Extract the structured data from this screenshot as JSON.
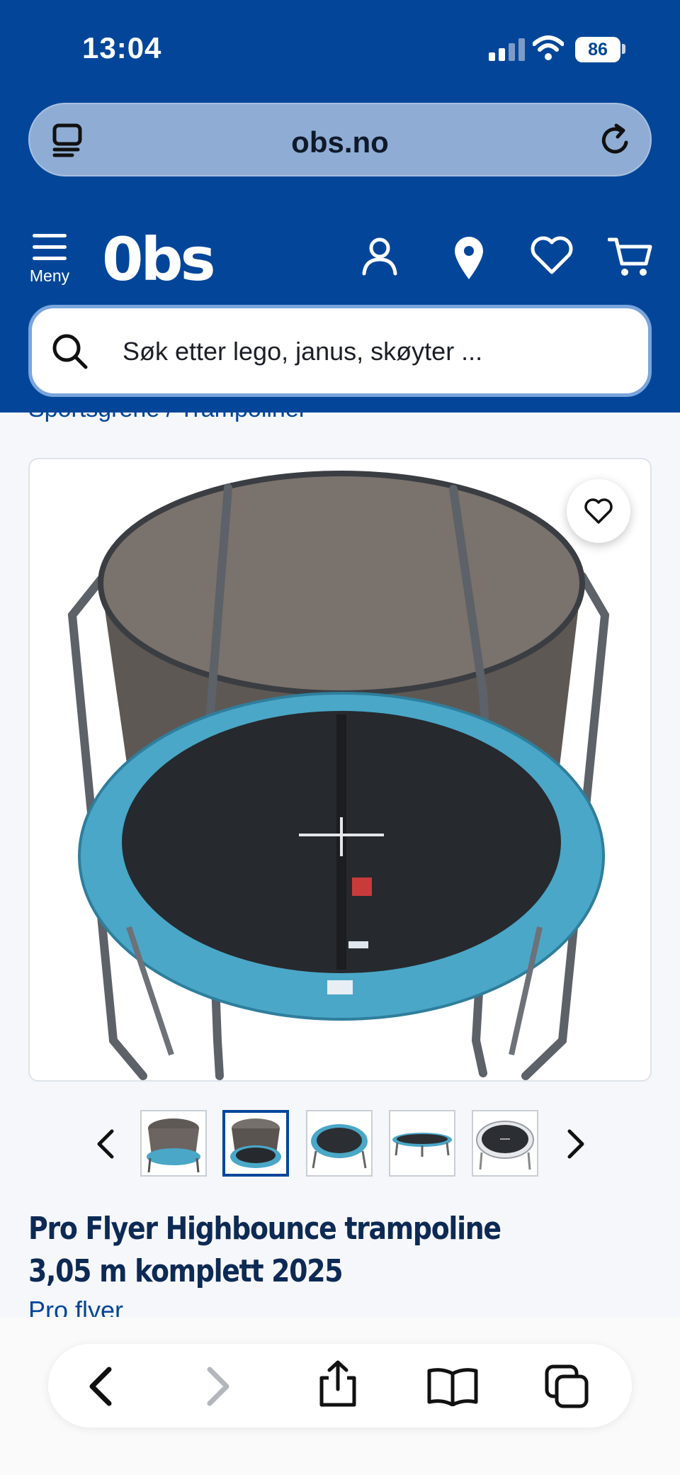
{
  "status_bar": {
    "time": "13:04",
    "battery": "86"
  },
  "browser": {
    "url": "obs.no"
  },
  "site_header": {
    "menu_label": "Meny",
    "logo_text": "0bs",
    "search_placeholder": "Søk etter lego, janus, skøyter ..."
  },
  "breadcrumb": {
    "text": "Sportsgrene / Trampoliner"
  },
  "product": {
    "title": "Pro Flyer Highbounce trampoline 3,05 m komplett 2025",
    "brand": "Pro flyer",
    "gallery": {
      "thumbnail_count": 5,
      "active_index": 1
    }
  },
  "colors": {
    "brand_blue": "#034699",
    "pad_blue": "#4aa7c8",
    "title_navy": "#0d2a55"
  },
  "icons": [
    "tabs-icon",
    "reload-icon",
    "menu-icon",
    "user-icon",
    "location-icon",
    "heart-icon",
    "cart-icon",
    "search-icon",
    "chevron-left-icon",
    "chevron-right-icon",
    "back-icon",
    "forward-icon",
    "share-icon",
    "bookmarks-icon",
    "tab-switcher-icon"
  ]
}
